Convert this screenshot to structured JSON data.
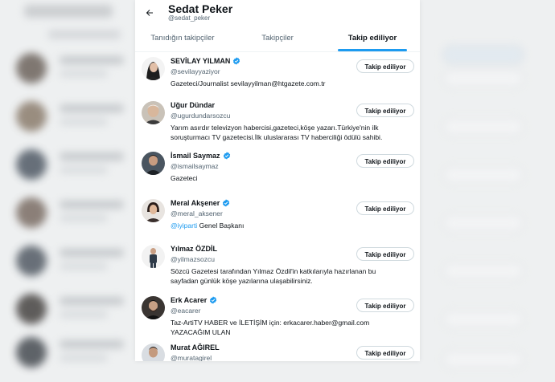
{
  "header": {
    "name": "Sedat Peker",
    "handle": "@sedat_peker"
  },
  "tabs": [
    {
      "label": "Tanıdığın takipçiler",
      "active": false
    },
    {
      "label": "Takipçiler",
      "active": false
    },
    {
      "label": "Takip ediliyor",
      "active": true
    }
  ],
  "colors": {
    "accent": "#1d9bf0",
    "text": "#0f1419",
    "muted": "#536471"
  },
  "users": [
    {
      "name": "SEVİLAY YILMAN",
      "verified": true,
      "handle": "@sevilayyaziyor",
      "bio_pre": "",
      "bio_mention": "",
      "bio": "Gazeteci/Journalist sevilayyilman@htgazete.com.tr",
      "button": "Takip ediliyor",
      "avatar_color": "#2b2b2b"
    },
    {
      "name": "Uğur Dündar",
      "verified": false,
      "handle": "@ugurdundarsozcu",
      "bio_pre": "",
      "bio_mention": "",
      "bio": "Yarım asırdır televizyon habercisi,gazeteci,köşe yazarı.Türkiye'nin ilk soruşturmacı TV gazetecisi.İlk uluslararası TV haberciliği ödülü sahibi.",
      "button": "Takip ediliyor",
      "avatar_color": "#8a7a68"
    },
    {
      "name": "İsmail Saymaz",
      "verified": true,
      "handle": "@ismailsaymaz",
      "bio_pre": "",
      "bio_mention": "",
      "bio": "Gazeteci",
      "button": "Takip ediliyor",
      "avatar_color": "#3d4650"
    },
    {
      "name": "Meral Akşener",
      "verified": true,
      "handle": "@meral_aksener",
      "bio_pre": "",
      "bio_mention": "@iyiparti",
      "bio": " Genel Başkanı",
      "button": "Takip ediliyor",
      "avatar_color": "#4a3a34"
    },
    {
      "name": "Yılmaz ÖZDİL",
      "verified": false,
      "handle": "@yilmazsozcu",
      "bio_pre": "",
      "bio_mention": "",
      "bio": "Sözcü Gazetesi tarafından Yılmaz Özdil'in katkılarıyla hazırlanan bu sayfadan günlük köşe yazılarına ulaşabilirsiniz.",
      "button": "Takip ediliyor",
      "avatar_color": "#35404a"
    },
    {
      "name": "Erk Acarer",
      "verified": true,
      "handle": "@eacarer",
      "bio_pre": "",
      "bio_mention": "",
      "bio": "Taz-ArtiTV HABER ve İLETİŞİM için: erkacarer.haber@gmail.com YAZACAĞIM ULAN",
      "button": "Takip ediliyor",
      "avatar_color": "#2e2a28"
    },
    {
      "name": "Murat AĞIREL",
      "verified": false,
      "handle": "@muratagirel",
      "bio_pre": "",
      "bio_mention": "",
      "bio": "",
      "button": "Takip ediliyor",
      "avatar_color": "#2c3138"
    }
  ]
}
